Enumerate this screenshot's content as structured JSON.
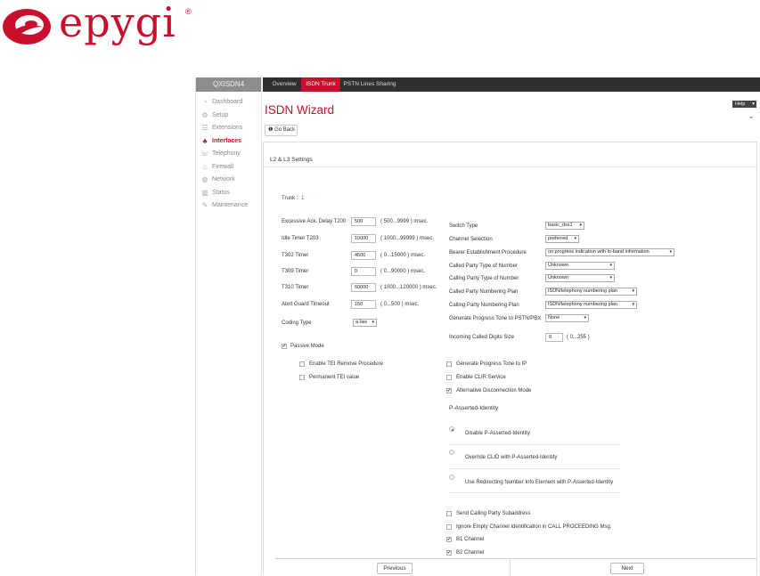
{
  "brand": {
    "logo_text": "epygi",
    "registered": "®",
    "color": "#c8102e"
  },
  "sidebar": {
    "product": "QXISDN4",
    "items": [
      {
        "icon": "dashboard-icon",
        "glyph": "◔",
        "label": "Dashboard"
      },
      {
        "icon": "gear-icon",
        "glyph": "⚙",
        "label": "Setup"
      },
      {
        "icon": "extensions-icon",
        "glyph": "☰",
        "label": "Extensions"
      },
      {
        "icon": "interfaces-icon",
        "glyph": "♣",
        "label": "Interfaces",
        "active": true
      },
      {
        "icon": "phone-icon",
        "glyph": "☏",
        "label": "Telephony"
      },
      {
        "icon": "flame-icon",
        "glyph": "♨",
        "label": "Firewall"
      },
      {
        "icon": "globe-icon",
        "glyph": "◍",
        "label": "Network"
      },
      {
        "icon": "status-chart-icon",
        "glyph": "▥",
        "label": "Status"
      },
      {
        "icon": "wrench-icon",
        "glyph": "✎",
        "label": "Maintenance"
      }
    ]
  },
  "tabs": [
    {
      "label": "Overview"
    },
    {
      "label": "ISDN Trunk",
      "active": true
    },
    {
      "label": "PSTN Lines Sharing"
    }
  ],
  "header": {
    "title": "ISDN Wizard",
    "help": "Help",
    "go_back": "Go Back"
  },
  "section": {
    "title": "L2 & L3 Settings",
    "trunk_label": "Trunk :",
    "trunk_value": "1"
  },
  "left_fields": [
    {
      "label": "Excessive Ack. Delay T200",
      "value": "500",
      "hint": "( 500...9999 ) msec."
    },
    {
      "label": "Idle Timer T203",
      "value": "10000",
      "hint": "( 1000...99999 ) msec."
    },
    {
      "label": "T302 Timer",
      "value": "4500",
      "hint": "( 0...15000 ) msec."
    },
    {
      "label": "T309 Timer",
      "value": "0",
      "hint": "( 0...90000 ) msec."
    },
    {
      "label": "T310 Timer",
      "value": "60000",
      "hint": "( 1000...120000 ) msec."
    },
    {
      "label": "Alert Guard Timeout",
      "value": "150",
      "hint": "( 0...500 ) msec."
    }
  ],
  "coding_type": {
    "label": "Coding Type",
    "value": "a-law"
  },
  "passive_mode": {
    "label": "Passive Mode",
    "checked": true
  },
  "tei_options": [
    {
      "label": "Enable TEI Remove Procedure",
      "checked": false
    },
    {
      "label": "Permanent TEI value",
      "checked": false
    }
  ],
  "right_selects": [
    {
      "label": "Switch Type",
      "value": "basic_dss1"
    },
    {
      "label": "Channel Selection",
      "value": "preferred"
    },
    {
      "label": "Bearer Establishment Procedure",
      "value": "on progress indication with in-band information"
    },
    {
      "label": "Called Party Type of Number",
      "value": "Unknown"
    },
    {
      "label": "Calling Party Type of Number",
      "value": "Unknown"
    },
    {
      "label": "Called Party Numbering Plan",
      "value": "ISDN/telephony numbering plan"
    },
    {
      "label": "Calling Party Numbering Plan",
      "value": "ISDN/telephony numbering plan"
    },
    {
      "label": "Generate Progress Tone to PSTN/PBX",
      "value": "None"
    }
  ],
  "incoming_digits": {
    "label": "Incoming Called Digits Size",
    "value": "0",
    "hint": "( 0...255 )"
  },
  "right_checks": [
    {
      "label": "Generate Progress Tone to IP",
      "checked": false
    },
    {
      "label": "Enable CLIR Service",
      "checked": false
    },
    {
      "label": "Alternative Disconnection Mode",
      "checked": true
    }
  ],
  "pai": {
    "title": "P-Asserted-Identity",
    "options": [
      {
        "label": "Disable P-Asserted-Identity",
        "selected": true
      },
      {
        "label": "Override CLID with P-Asserted-Identity",
        "selected": false
      },
      {
        "label": "Use Redirecting Number Info Element with P-Asserted-Identity",
        "selected": false
      }
    ]
  },
  "bottom_checks": [
    {
      "label": "Send Calling Party Subaddress",
      "checked": false
    },
    {
      "label": "Ignore Empty Channel Identification in CALL PROCEEDING Msg.",
      "checked": false
    },
    {
      "label": "B1 Channel",
      "checked": true
    },
    {
      "label": "B2 Channel",
      "checked": true
    }
  ],
  "buttons": {
    "previous": "Previous",
    "next": "Next"
  }
}
